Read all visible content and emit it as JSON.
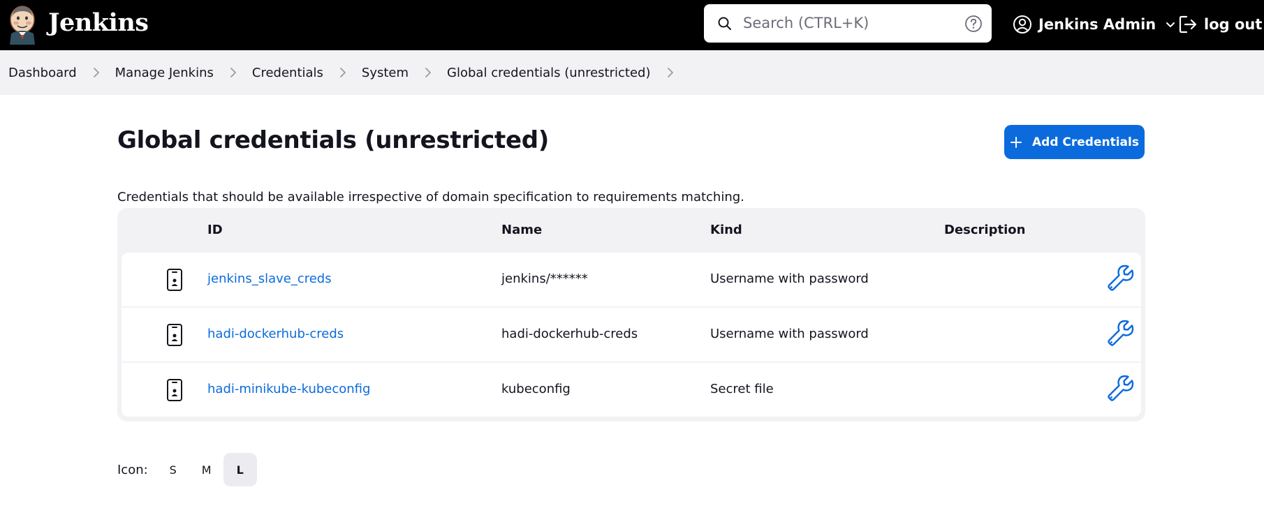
{
  "header": {
    "brand": "Jenkins",
    "search_placeholder": "Search (CTRL+K)",
    "user_name": "Jenkins Admin",
    "logout_label": "log out"
  },
  "breadcrumbs": [
    "Dashboard",
    "Manage Jenkins",
    "Credentials",
    "System",
    "Global credentials (unrestricted)"
  ],
  "page": {
    "title": "Global credentials (unrestricted)",
    "add_button": "Add Credentials",
    "description": "Credentials that should be available irrespective of domain specification to requirements matching."
  },
  "table": {
    "headers": {
      "id": "ID",
      "name": "Name",
      "kind": "Kind",
      "description": "Description"
    },
    "rows": [
      {
        "id": "jenkins_slave_creds",
        "name": "jenkins/******",
        "kind": "Username with password",
        "description": ""
      },
      {
        "id": "hadi-dockerhub-creds",
        "name": "hadi-dockerhub-creds",
        "kind": "Username with password",
        "description": ""
      },
      {
        "id": "hadi-minikube-kubeconfig",
        "name": "kubeconfig",
        "kind": "Secret file",
        "description": ""
      }
    ]
  },
  "icon_size": {
    "label": "Icon:",
    "options": [
      "S",
      "M",
      "L"
    ],
    "selected": "L"
  },
  "colors": {
    "accent": "#0b6bdc",
    "header_bg": "#000000",
    "panel_bg": "#f2f2f5"
  }
}
